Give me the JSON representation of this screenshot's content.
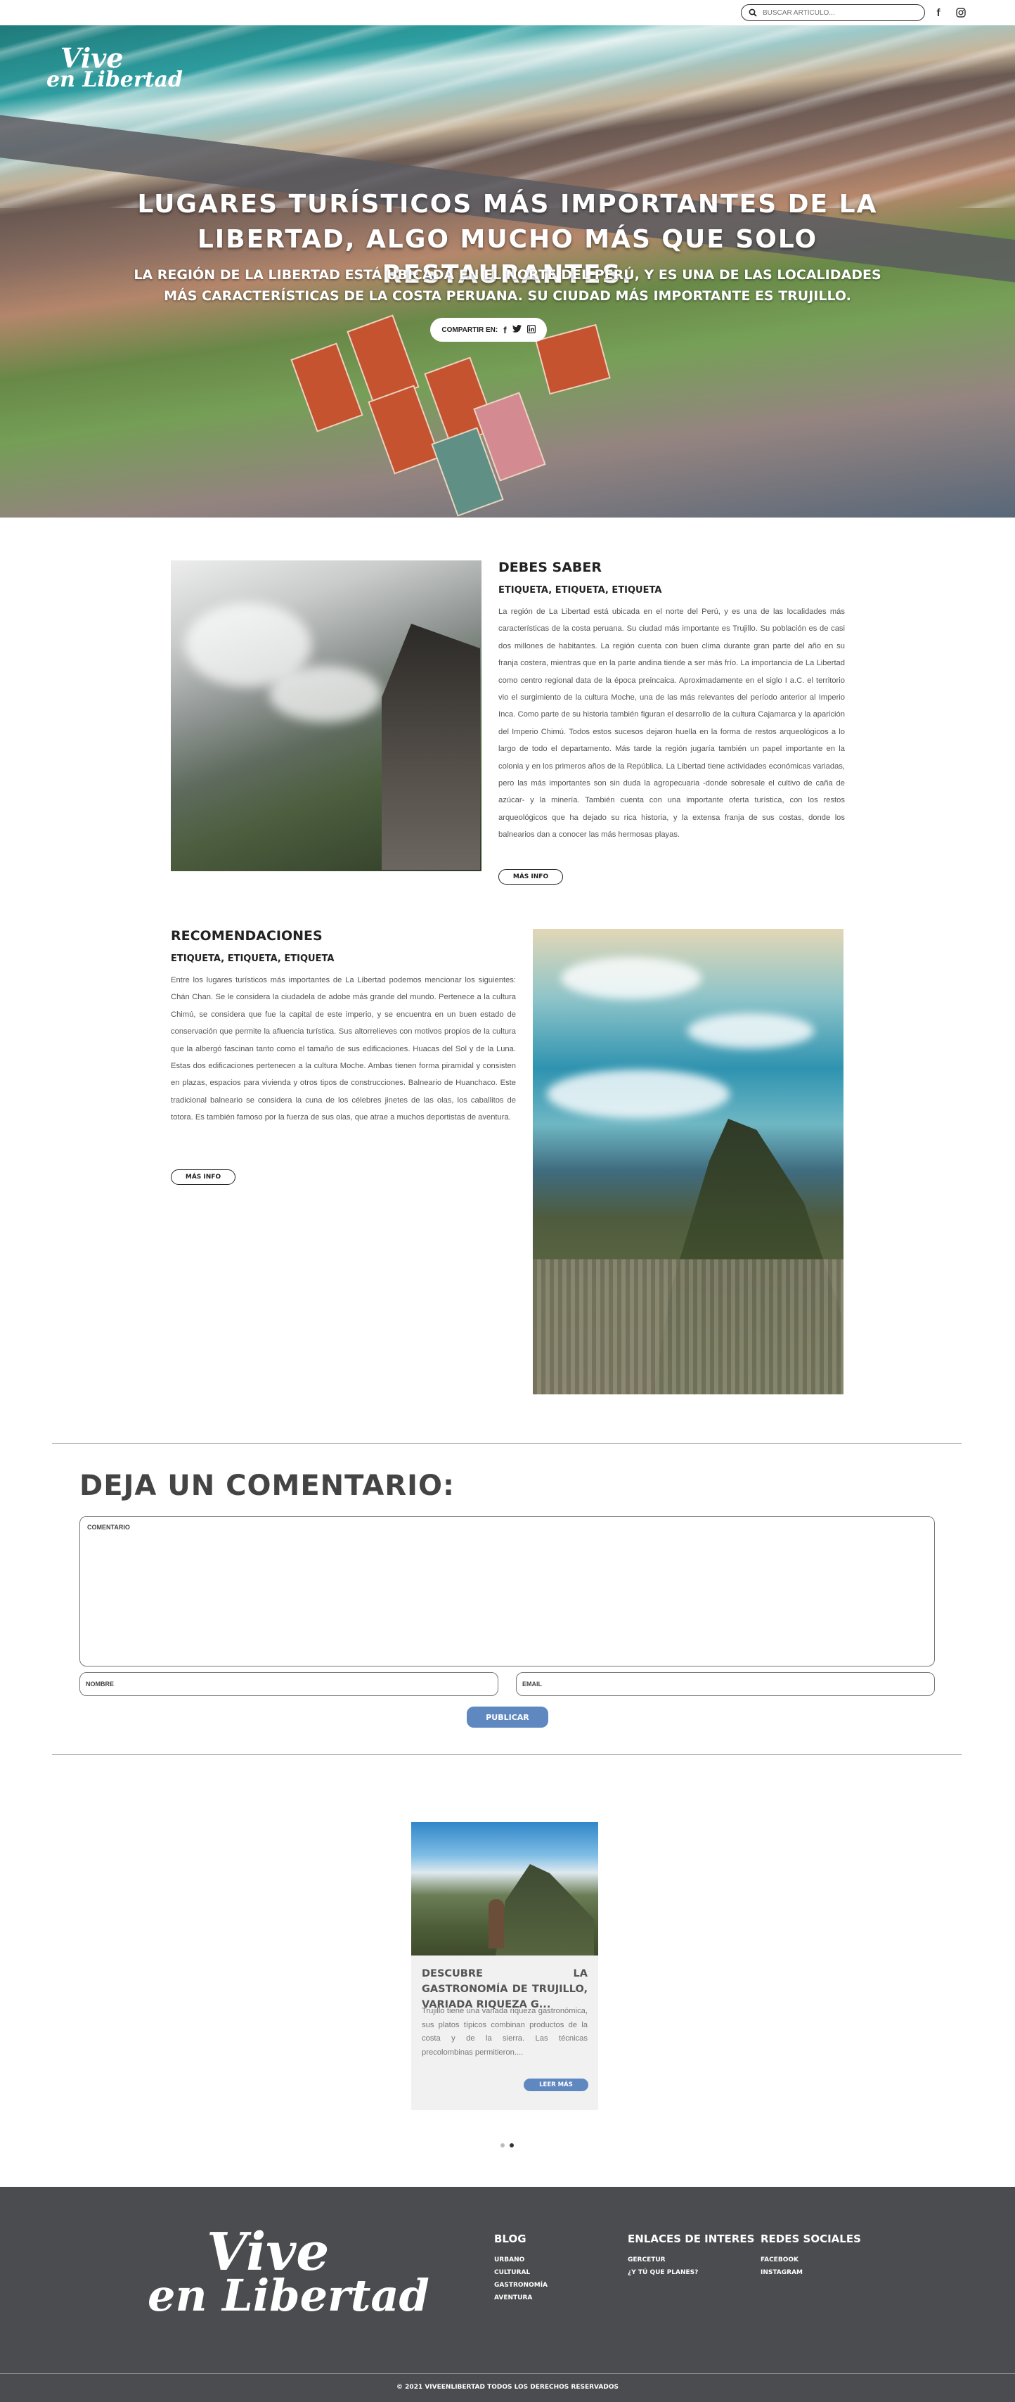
{
  "header": {
    "search_placeholder": "BUSCAR ARTÍCULO...",
    "social": {
      "facebook": "f",
      "instagram": "◎"
    }
  },
  "hero": {
    "logo_line1": "Vive",
    "logo_line2": "en Libertad",
    "title": "LUGARES TURÍSTICOS MÁS IMPORTANTES DE LA LIBERTAD, ALGO MUCHO MÁS QUE SOLO RESTAURANTES.",
    "subtitle": "LA REGIÓN DE LA LIBERTAD ESTÁ UBICADA EN EL NORTE DEL PERÚ, Y ES UNA DE LAS LOCALIDADES MÁS CARACTERÍSTICAS DE LA COSTA PERUANA. SU CIUDAD MÁS IMPORTANTE ES TRUJILLO.",
    "share_label": "COMPARTIR EN:",
    "share_icons": {
      "facebook": "f",
      "twitter": "t",
      "linkedin": "in"
    }
  },
  "sections": [
    {
      "title": "DEBES SABER",
      "tags": "ETIQUETA, ETIQUETA, ETIQUETA",
      "body": "La región de La Libertad está ubicada en el norte del Perú, y es una de las localidades más características de la costa peruana. Su ciudad más importante es Trujillo. Su población es de casi dos millones de habitantes. La región cuenta con buen clima durante gran parte del año en su franja costera, mientras que en la parte andina tiende a ser más frío. La importancia de La Libertad como centro regional data de la época preincaica. Aproximadamente en el siglo I a.C. el territorio vio el surgimiento de la cultura Moche, una de las más relevantes del período anterior al Imperio Inca. Como parte de su historia también figuran el desarrollo de la cultura Cajamarca y la aparición del Imperio Chimú. Todos estos sucesos dejaron huella en la forma de restos arqueológicos a lo largo de todo el departamento. Más tarde la región jugaría también un papel importante en la colonia y en los primeros años de la República. La Libertad tiene actividades económicas variadas, pero las más importantes son sin duda la agropecuaria -donde sobresale el cultivo de caña de azúcar- y la minería. También cuenta con una importante oferta turística, con los restos arqueológicos que ha dejado su rica historia, y la extensa franja de sus costas, donde los balnearios dan a conocer las más hermosas playas.",
      "button": "MÁS INFO"
    },
    {
      "title": "RECOMENDACIONES",
      "tags": "ETIQUETA, ETIQUETA, ETIQUETA",
      "body": "Entre los lugares turísticos más importantes de La Libertad podemos mencionar los siguientes: Chán Chan. Se le considera la ciudadela de adobe más grande del mundo. Pertenece a la cultura Chimú, se considera que fue la capital de este imperio, y se encuentra en un buen estado de conservación que permite la afluencia turística. Sus altorrelieves con motivos propios de la cultura que la albergó fascinan tanto como el tamaño de sus edificaciones. Huacas del Sol y de la Luna. Estas dos edificaciones pertenecen a la cultura Moche. Ambas tienen forma piramidal y consisten en plazas, espacios para vivienda y otros tipos de construcciones. Balneario de Huanchaco. Este tradicional balneario se considera la cuna de los célebres jinetes de las olas, los caballitos de totora. Es también famoso por la fuerza de sus olas, que atrae a muchos deportistas de aventura.",
      "button": "MÁS INFO"
    }
  ],
  "comment": {
    "title": "DEJA UN COMENTARIO:",
    "comment_placeholder": "COMENTARIO",
    "name_placeholder": "NOMBRE",
    "email_placeholder": "EMAIL",
    "submit": "PUBLICAR"
  },
  "card": {
    "title": "DESCUBRE LA GASTRONOMÍA DE TRUJILLO, VARIADA RIQUEZA G...",
    "text": "Trujillo tiene una variada riqueza gastronómica, sus platos típicos combinan productos de la costa y de la sierra. Las técnicas precolombinas permitieron....",
    "button": "LEER MÁS"
  },
  "carousel": {
    "active_index": 1,
    "count": 2
  },
  "footer": {
    "logo_line1": "Vive",
    "logo_line2": "en Libertad",
    "blog": {
      "title": "BLOG",
      "links": [
        "URBANO",
        "CULTURAL",
        "GASTRONOMÍA",
        "AVENTURA"
      ]
    },
    "enlaces": {
      "title": "ENLACES DE INTERES",
      "links": [
        "GERCETUR",
        "¿Y TÚ QUE PLANES?"
      ]
    },
    "redes": {
      "title": "REDES SOCIALES",
      "links": [
        "FACEBOOK",
        "INSTAGRAM"
      ]
    },
    "copyright": "© 2021 VIVEENLIBERTAD TODOS LOS DERECHOS RESERVADOS"
  }
}
